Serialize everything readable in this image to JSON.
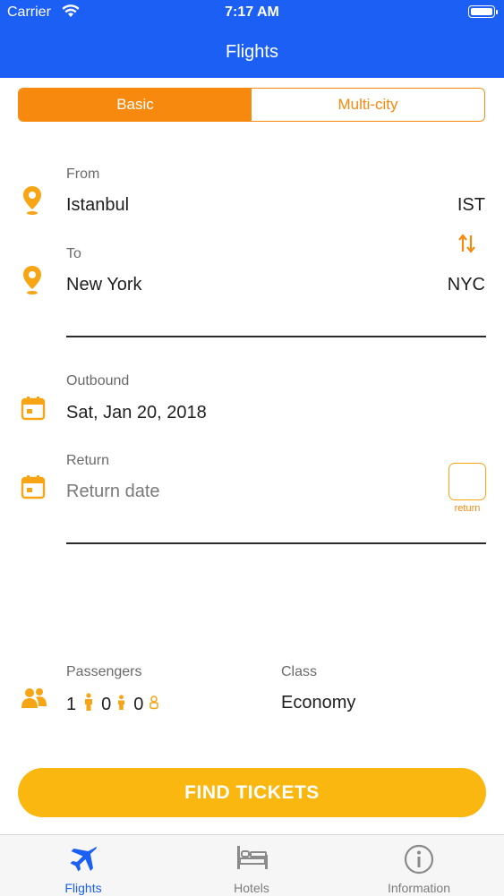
{
  "status_bar": {
    "carrier": "Carrier",
    "time": "7:17 AM"
  },
  "header": {
    "title": "Flights"
  },
  "segment": {
    "basic": "Basic",
    "multi_city": "Multi-city",
    "selected": "Basic"
  },
  "route": {
    "from_label": "From",
    "from_city": "Istanbul",
    "from_code": "IST",
    "to_label": "To",
    "to_city": "New York",
    "to_code": "NYC"
  },
  "dates": {
    "outbound_label": "Outbound",
    "outbound_value": "Sat, Jan 20, 2018",
    "return_label": "Return",
    "return_placeholder": "Return date",
    "return_toggle_label": "return"
  },
  "passengers": {
    "label": "Passengers",
    "adults": "1",
    "children": "0",
    "infants": "0"
  },
  "cabin_class": {
    "label": "Class",
    "value": "Economy"
  },
  "find_button": "FIND TICKETS",
  "tab_bar": {
    "flights": "Flights",
    "hotels": "Hotels",
    "information": "Information",
    "active": "Flights"
  },
  "colors": {
    "header_blue": "#1c5ff5",
    "accent_orange": "#f7890f",
    "icon_orange": "#f7a415",
    "button_yellow": "#f9b70f"
  }
}
